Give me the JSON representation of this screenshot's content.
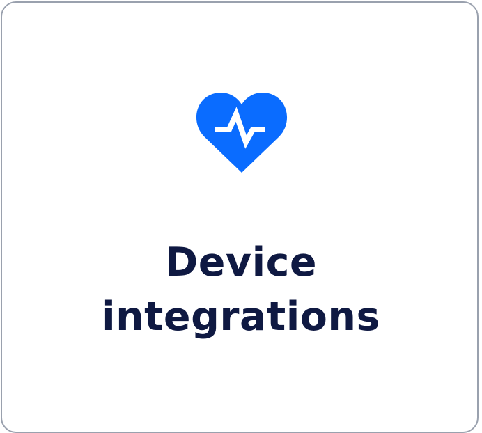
{
  "card": {
    "title_line1": "Device",
    "title_line2": "integrations",
    "icon": "heart-pulse-icon"
  },
  "colors": {
    "accent": "#0a6cff",
    "title_text": "#0f1942",
    "card_border": "#9aa1ae",
    "background": "#ffffff"
  }
}
